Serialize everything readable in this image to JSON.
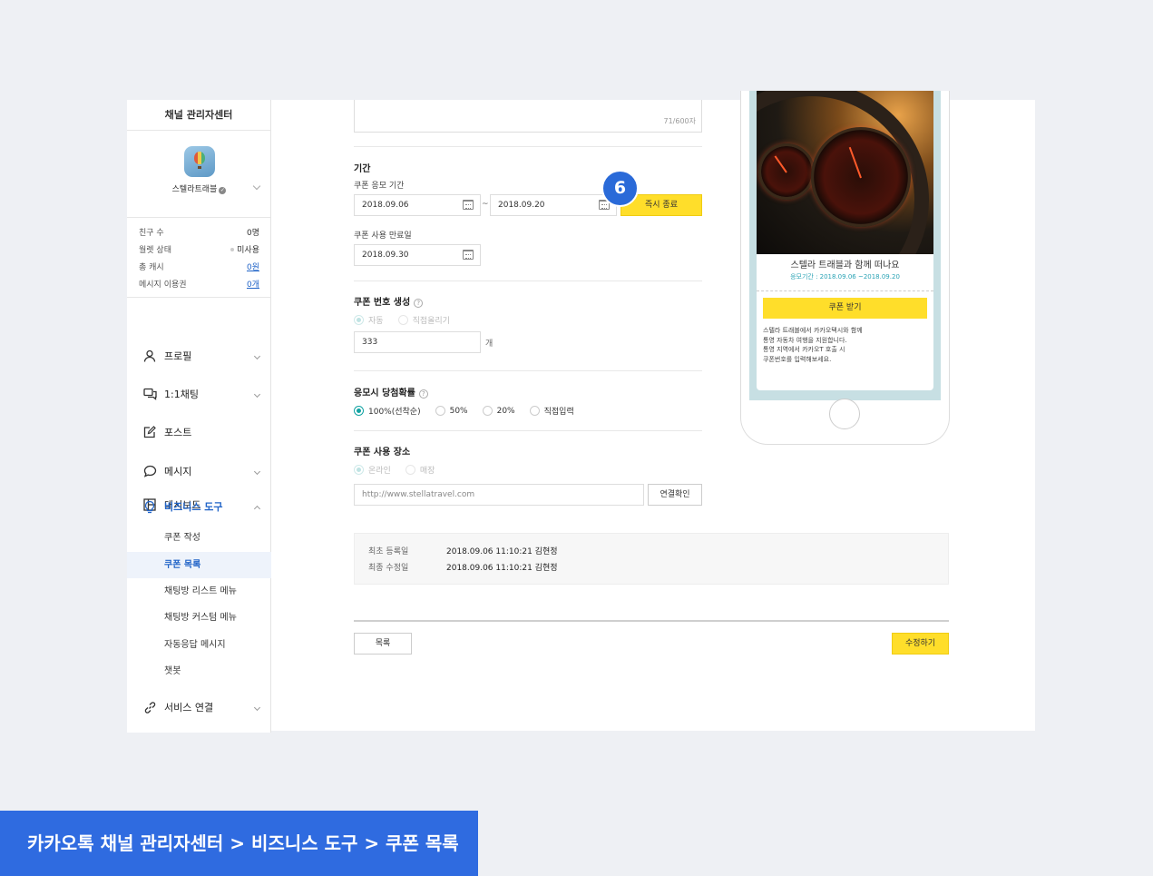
{
  "sidebar": {
    "title": "채널 관리자센터",
    "profile_name": "스텔라트래블",
    "stats": [
      {
        "label": "친구 수",
        "value": "0명"
      },
      {
        "label": "월렛 상태",
        "value": "미사용"
      },
      {
        "label": "총 캐시",
        "value": "0원"
      },
      {
        "label": "메시지 이용권",
        "value": "0개"
      }
    ],
    "menu": {
      "dashboard": "대시보드",
      "profile": "프로필",
      "chat": "1:1채팅",
      "post": "포스트",
      "message": "메시지",
      "business": "비즈니스 도구",
      "service": "서비스 연결"
    },
    "submenu": [
      "쿠폰 작성",
      "쿠폰 목록",
      "채팅방 리스트 메뉴",
      "채팅방 커스텀 메뉴",
      "자동응답 메시지",
      "챗봇"
    ]
  },
  "form": {
    "counter": "71/600자",
    "period_heading": "기간",
    "apply_period_label": "쿠폰 응모 기간",
    "start_date": "2018.09.06",
    "tilde": "~",
    "end_date": "2018.09.20",
    "end_now_button": "즉시 종료",
    "step_badge": "6",
    "expire_label": "쿠폰 사용 만료일",
    "expire_date": "2018.09.30",
    "number_heading": "쿠폰 번호 생성",
    "number_auto": "자동",
    "number_upload": "직접올리기",
    "number_count": "333",
    "number_unit": "개",
    "prob_heading": "응모시 당첨확률",
    "prob_options": [
      "100%(선착순)",
      "50%",
      "20%",
      "직접입력"
    ],
    "place_heading": "쿠폰 사용 장소",
    "place_online": "온라인",
    "place_store": "매장",
    "url_placeholder": "http://www.stellatravel.com",
    "url_check_button": "연결확인"
  },
  "meta": {
    "created_label": "최초 등록일",
    "created_value": "2018.09.06 11:10:21 김현정",
    "modified_label": "최종 수정일",
    "modified_value": "2018.09.06 11:10:21 김현정"
  },
  "actions": {
    "list_button": "목록",
    "edit_button": "수정하기"
  },
  "preview": {
    "title": "스텔라 트래블과 함께 떠나요",
    "period": "응모기간 : 2018.09.06 ~2018.09.20",
    "button": "쿠폰 받기",
    "desc": [
      "스텔라 트래블에서 카카오택시와 함께",
      "통영 자동차 여행을 지원합니다.",
      "통영 지역에서 카카오T 호출 시",
      "쿠폰번호를 입력해보세요."
    ]
  },
  "footer": {
    "breadcrumb": "카카오톡 채널 관리자센터 > 비즈니스 도구 > 쿠폰 목록"
  },
  "colors": {
    "accent_blue": "#2265c8",
    "button_yellow": "#ffde2a",
    "radio_teal": "#12a3a3",
    "footer_blue": "#2f6be0"
  }
}
